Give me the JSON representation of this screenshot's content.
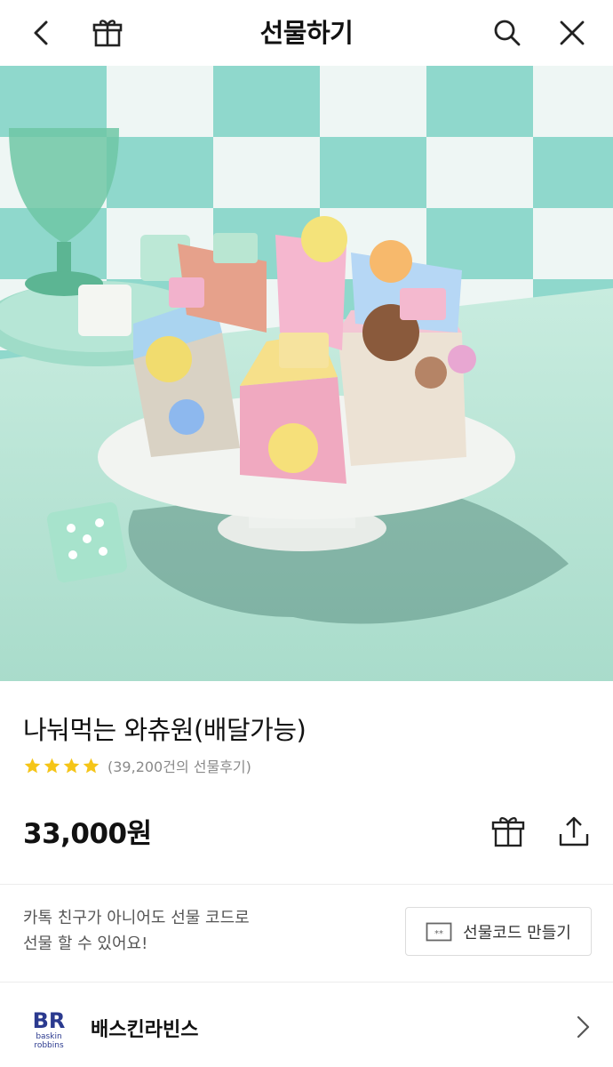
{
  "header": {
    "title": "선물하기",
    "back_icon": "chevron-left-icon",
    "gift_icon": "gift-icon",
    "search_icon": "search-icon",
    "close_icon": "close-icon"
  },
  "product": {
    "name": "나눠먹는 와츄원(배달가능)",
    "rating": {
      "stars": 4,
      "max": 5,
      "color": "#f5c518",
      "review_text": "(39,200건의 선물후기)"
    },
    "price": "33,000원"
  },
  "actions": {
    "gift_icon": "gift-box-icon",
    "share_icon": "share-icon"
  },
  "gift_code": {
    "description_line1": "카톡 친구가 아니어도 선물 코드로",
    "description_line2": "선물 할 수 있어요!",
    "button_label": "선물코드 만들기",
    "button_icon": "ticket-icon"
  },
  "brand": {
    "name": "배스킨라빈스",
    "logo_text_top": "BR",
    "logo_text_line1": "baskin",
    "logo_text_line2": "robbins",
    "colors": {
      "blue": "#2b3a8f",
      "pink": "#e8437f"
    }
  }
}
